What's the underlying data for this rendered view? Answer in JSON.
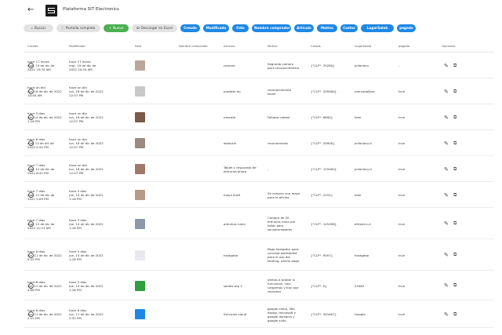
{
  "app": {
    "title": "Plataforma SIT Electronics"
  },
  "icons": {
    "back": "arrow-left-icon",
    "logo": "sit-logo-icon",
    "edit": "pencil-icon",
    "copy": "copy-icon"
  },
  "toolbar": {
    "buttons": [
      {
        "label": "Buscar",
        "icon": "⌕",
        "style": "gray"
      },
      {
        "label": "Pantalla completa",
        "icon": "⛶",
        "style": "gray"
      },
      {
        "label": "Nuevo",
        "icon": "+",
        "style": "green"
      },
      {
        "label": "Descargar en Excel",
        "icon": "⊞",
        "style": "gray"
      },
      {
        "label": "Creado",
        "style": "blue"
      },
      {
        "label": "Modificado",
        "style": "blue"
      },
      {
        "label": "Foto",
        "style": "blue"
      },
      {
        "label": "Nombre comprador",
        "style": "blue"
      },
      {
        "label": "Artículo",
        "style": "blue"
      },
      {
        "label": "Motivo",
        "style": "blue"
      },
      {
        "label": "Costos",
        "style": "blue"
      },
      {
        "label": "LugarSaleb",
        "style": "blue"
      },
      {
        "label": "pagado",
        "style": "blue"
      }
    ]
  },
  "table": {
    "headers": [
      "Creado",
      "Modificado",
      "Foto",
      "Nombre comprador",
      "Artículo",
      "Motivo",
      "Costos",
      "LugarSaleb",
      "pagado",
      "Opciones"
    ],
    "rows": [
      {
        "created": [
          "hace 17 horas",
          "mar, 19 de dic de",
          "2022 10:34 AM"
        ],
        "modified": [
          "hace 17 horas",
          "mar, 19 de dic de",
          "2022 10:34 AM"
        ],
        "photo_color": "#b9a79a",
        "article": [
          "camara"
        ],
        "reason": [
          "Segunda camara",
          "para reconocimiento"
        ],
        "cost": "{\"CLP\": 35280}",
        "place": "pcfactory",
        "paid": "-"
      },
      {
        "created": [
          "hace un día",
          "lun, 18 de dic de 2022",
          "10:40 AM"
        ],
        "modified": [
          "hace un día",
          "lun, 18 de dic de 2022",
          "12:57 PM"
        ],
        "photo_color": "#c8c8c8",
        "article": [
          "prodesk hp"
        ],
        "reason": [
          "reconocimiento",
          "facial"
        ],
        "cost": "{\"CLP\": 209900}",
        "place": "mercadolibre",
        "paid": "true"
      },
      {
        "created": [
          "hace 5 días",
          "jue, 14 de dic de 2022",
          "1:16 PM"
        ],
        "modified": [
          "hace un día",
          "lun, 18 de dic de 2022",
          "12:57 PM"
        ],
        "photo_color": "#7a5a48",
        "article": [
          "nescafe"
        ],
        "reason": [
          "Faltaba cafeee"
        ],
        "cost": "{\"CLP\": 6890}",
        "place": "lider",
        "paid": "true"
      },
      {
        "created": [
          "hace 6 días",
          "mié, 13 de dic de",
          "2022 5:34 PM"
        ],
        "modified": [
          "hace un día",
          "lun, 18 de dic de 2022",
          "12:57 PM"
        ],
        "photo_color": "#9a8a80",
        "article": [
          "webcam"
        ],
        "reason": [
          "reconomenos"
        ],
        "cost": "{\"CLP\": 20900}",
        "place": "pcfactory.cl",
        "paid": "true"
      },
      {
        "created": [
          "hace 7 días",
          "mar, 12 de dic de",
          "2022 6:42 PM"
        ],
        "modified": [
          "hace un día",
          "lun, 18 de dic de 2022",
          "12:57 PM"
        ],
        "photo_color": "#a07a6a",
        "article": [
          "Tablet y respuesto de",
          "ektrunta ahora"
        ],
        "reason": [
          "-"
        ],
        "cost": "{\"CLP\": 125000}",
        "place": "pcfactory.cl",
        "paid": "true"
      },
      {
        "created": [
          "hace 7 días",
          "mar, 12 de dic de",
          "2022 2:09 PM"
        ],
        "modified": [
          "hace 5 días",
          "jue, 14 de dic de 2022",
          "1:16 PM"
        ],
        "photo_color": "#b89a8a",
        "article": [
          "mayo kraft"
        ],
        "reason": [
          "Se compro una mayo",
          "para la oficina"
        ],
        "cost": "{\"CLP\": 2252}",
        "place": "lider",
        "paid": "true"
      },
      {
        "created": [
          "hace 7 días",
          "mar, 12 de dic de",
          "2022 11:51 AM"
        ],
        "modified": [
          "hace 5 días",
          "jue, 14 de dic de 2022",
          "1:16 PM"
        ],
        "photo_color": "#8c98a8",
        "article": [
          "arduinos nano"
        ],
        "reason": [
          "Compra de 30",
          "arduinos nano por",
          "fallas para",
          "sensoremoteros"
        ],
        "cost": "{\"CLP\": 145498}",
        "place": "altronics.cl",
        "paid": "true"
      },
      {
        "created": [
          "hace 8 días",
          "lun, 11 de dic de 2022",
          "5:15 PM"
        ],
        "modified": [
          "hace 5 días",
          "jue, 14 de dic de 2022",
          "1:16 PM"
        ],
        "photo_color": "#e8e8ee",
        "article": [
          "hostgator"
        ],
        "reason": [
          "Pago hostgator para",
          "concept.websalded",
          "para el uso del",
          "landing, ultimo pago"
        ],
        "cost": "{\"CLP\": 9597}",
        "place": "hostgator",
        "paid": "true"
      },
      {
        "created": [
          "hace 8 días",
          "lun, 11 de dic de 2022",
          "4:08 PM"
        ],
        "modified": [
          "hace 5 días",
          "jue, 14 de dic de 2022",
          "1:16 PM"
        ],
        "photo_color": "#2e9e3e",
        "article": [
          "saldes.org 3"
        ],
        "reason": [
          "Vamos a probar si",
          "funcionan, sino",
          "cargamos y hay que",
          "reclamar"
        ],
        "cost": "{\"CLP\": 0}",
        "place": "25482",
        "paid": "true"
      },
      {
        "created": [
          "hace 8 días",
          "lun, 11 de dic de 2022",
          "2:15 PM"
        ],
        "modified": [
          "hace 8 días",
          "lun, 11 de dic de 2022",
          "2:35 PM"
        ],
        "photo_color": "#1e88e5",
        "article": [
          "Servicios cloud"
        ],
        "reason": [
          "google cloud, 360",
          "dialog, microsoft y",
          "google domains y",
          "google suits"
        ],
        "cost": "{\"CLP\": 301607}",
        "place": "Google",
        "paid": "true"
      }
    ]
  }
}
